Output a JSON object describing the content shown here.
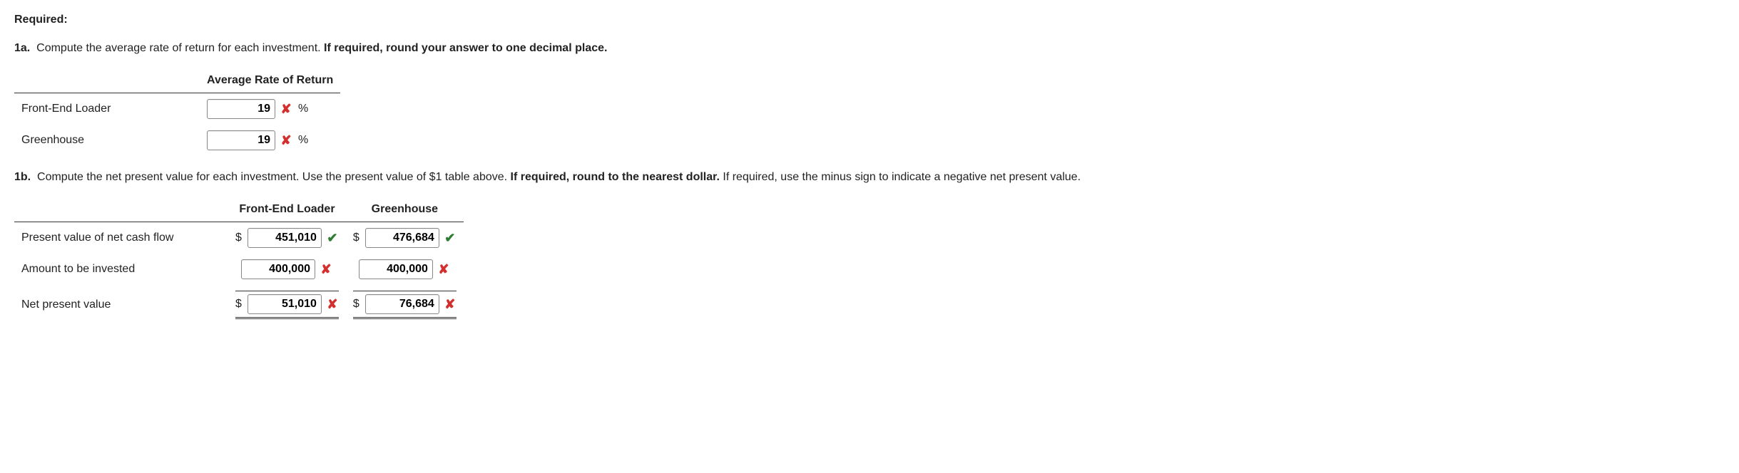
{
  "required_label": "Required:",
  "q1a": {
    "number": "1a.",
    "text": "Compute the average rate of return for each investment.",
    "bold_tail": "If required, round your answer to one decimal place.",
    "table_header": "Average Rate of Return",
    "rows": [
      {
        "label": "Front-End Loader",
        "value": "19",
        "mark": "wrong",
        "suffix": "%"
      },
      {
        "label": "Greenhouse",
        "value": "19",
        "mark": "wrong",
        "suffix": "%"
      }
    ]
  },
  "q1b": {
    "number": "1b.",
    "text": "Compute the net present value for each investment. Use the present value of $1 table above.",
    "bold_tail": "If required, round to the nearest dollar.",
    "tail2": "If required, use the minus sign to indicate a negative net present value.",
    "col_headers": [
      "Front-End Loader",
      "Greenhouse"
    ],
    "rows": [
      {
        "label": "Present value of net cash flow",
        "currency": "$",
        "cells": [
          {
            "value": "451,010",
            "mark": "correct"
          },
          {
            "value": "476,684",
            "mark": "correct"
          }
        ]
      },
      {
        "label": "Amount to be invested",
        "currency": "",
        "cells": [
          {
            "value": "400,000",
            "mark": "wrong"
          },
          {
            "value": "400,000",
            "mark": "wrong"
          }
        ]
      },
      {
        "label": "Net present value",
        "currency": "$",
        "cells": [
          {
            "value": "51,010",
            "mark": "wrong"
          },
          {
            "value": "76,684",
            "mark": "wrong"
          }
        ]
      }
    ]
  },
  "marks": {
    "correct": "✔",
    "wrong": "✘"
  }
}
